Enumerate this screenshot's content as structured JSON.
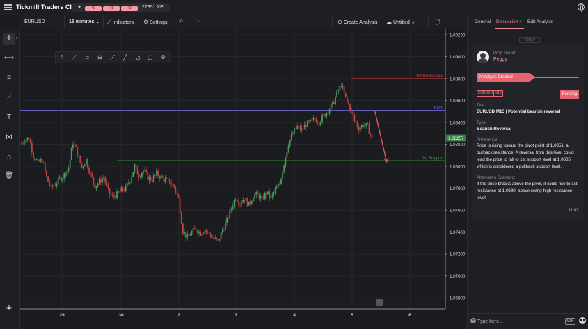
{
  "app": {
    "title": "Tickmill Traders Club",
    "xp_levels": [
      "40",
      "41",
      "42"
    ],
    "xp_value": "27851 XP"
  },
  "toolbar": {
    "symbol": "EURUSD",
    "interval": "15 minutes",
    "indicators": "Indicators",
    "settings": "Settings",
    "create_analysis": "Create Analysis",
    "layout_name": "Untitled"
  },
  "left_tools": [
    "crosshair-icon",
    "horizontal-line-icon",
    "fib-icon",
    "trendline-icon",
    "text-icon",
    "pattern-icon",
    "magnet-icon",
    "trash-icon",
    "layers-icon"
  ],
  "chart_data": {
    "type": "candlestick",
    "symbol": "EURUSD",
    "interval": "15 minutes",
    "y_ticks": [
      "1.09200",
      "1.09000",
      "1.08800",
      "1.08600",
      "1.08400",
      "1.08200",
      "1.08000",
      "1.07800",
      "1.07600",
      "1.07400",
      "1.07200",
      "1.07000",
      "1.06800"
    ],
    "x_ticks": [
      "29",
      "30",
      "2",
      "3",
      "4",
      "5",
      "6"
    ],
    "ylim": [
      1.067,
      1.0925
    ],
    "current_price": "1.08257",
    "levels": [
      {
        "name": "1st Resistance",
        "value": 1.088,
        "color": "#d9414b"
      },
      {
        "name": "Pivot",
        "value": 1.0851,
        "color": "#6b68d8"
      },
      {
        "name": "1st Support",
        "value": 1.0805,
        "color": "#3cb043"
      }
    ],
    "close_path": [
      [
        0,
        1.082
      ],
      [
        3,
        1.0824
      ],
      [
        6,
        1.0826
      ],
      [
        9,
        1.081
      ],
      [
        12,
        1.0803
      ],
      [
        15,
        1.0806
      ],
      [
        18,
        1.079
      ],
      [
        21,
        1.078
      ],
      [
        24,
        1.0784
      ],
      [
        27,
        1.0788
      ],
      [
        30,
        1.0792
      ],
      [
        33,
        1.0798
      ],
      [
        36,
        1.0822
      ],
      [
        39,
        1.0812
      ],
      [
        42,
        1.0799
      ],
      [
        45,
        1.0806
      ],
      [
        48,
        1.0792
      ],
      [
        51,
        1.0782
      ],
      [
        54,
        1.0786
      ],
      [
        57,
        1.079
      ],
      [
        60,
        1.0777
      ],
      [
        63,
        1.0772
      ],
      [
        66,
        1.0774
      ],
      [
        69,
        1.0778
      ],
      [
        72,
        1.078
      ],
      [
        75,
        1.0788
      ],
      [
        78,
        1.08
      ],
      [
        81,
        1.0792
      ],
      [
        84,
        1.0796
      ],
      [
        87,
        1.079
      ],
      [
        90,
        1.0788
      ],
      [
        93,
        1.0793
      ],
      [
        96,
        1.079
      ],
      [
        99,
        1.0787
      ],
      [
        102,
        1.0786
      ],
      [
        105,
        1.0781
      ],
      [
        108,
        1.077
      ],
      [
        111,
        1.0741
      ],
      [
        114,
        1.0735
      ],
      [
        117,
        1.074
      ],
      [
        120,
        1.0743
      ],
      [
        123,
        1.0739
      ],
      [
        126,
        1.0742
      ],
      [
        129,
        1.0738
      ],
      [
        132,
        1.0734
      ],
      [
        135,
        1.0731
      ],
      [
        138,
        1.0742
      ],
      [
        141,
        1.075
      ],
      [
        144,
        1.0762
      ],
      [
        147,
        1.0772
      ],
      [
        150,
        1.0767
      ],
      [
        153,
        1.0771
      ],
      [
        156,
        1.0765
      ],
      [
        159,
        1.0773
      ],
      [
        162,
        1.0774
      ],
      [
        165,
        1.077
      ],
      [
        168,
        1.0776
      ],
      [
        171,
        1.0771
      ],
      [
        174,
        1.0778
      ],
      [
        177,
        1.0784
      ],
      [
        180,
        1.0803
      ],
      [
        183,
        1.0821
      ],
      [
        186,
        1.083
      ],
      [
        189,
        1.0836
      ],
      [
        192,
        1.0833
      ],
      [
        195,
        1.0838
      ],
      [
        198,
        1.084
      ],
      [
        201,
        1.0843
      ],
      [
        204,
        1.0841
      ],
      [
        207,
        1.0846
      ],
      [
        210,
        1.0851
      ],
      [
        213,
        1.0856
      ],
      [
        216,
        1.0866
      ],
      [
        219,
        1.0875
      ],
      [
        222,
        1.0862
      ],
      [
        225,
        1.0853
      ],
      [
        228,
        1.0841
      ],
      [
        231,
        1.0835
      ],
      [
        234,
        1.0838
      ],
      [
        237,
        1.0836
      ],
      [
        240,
        1.0825
      ]
    ],
    "projection": [
      [
        242,
        1.085
      ],
      [
        250,
        1.0804
      ]
    ]
  },
  "panel": {
    "tabs": [
      "General",
      "Discussion",
      "Edit Analysis"
    ],
    "today_label": "TODAY",
    "author_role": "Prop Trader",
    "author_name": "Peggy",
    "status": "Analysis Created",
    "tags": [
      "EURUSD",
      "M15"
    ],
    "pending": "Pending",
    "title_label": "Title",
    "title_value": "EURUSD M15 | Potential bearish reversal",
    "type_label": "Type",
    "type_value": "Bearish Reversal",
    "preference_label": "Preference:",
    "preference_value": "Price is rising toward the pivot point of 1.0851, a pullback resistance. A reversal from this level could lead the price to fall to 1st  support level at 1.0805, which is considered a pullback support level.",
    "alternative_label": "Alternative Scenario:",
    "alternative_value": "If the price breaks above the pivot, it could rise to 1st resistance at 1.0880, above swing-high resistance level",
    "time": "11:07",
    "input_placeholder": "Type here...",
    "gif_label": "GIF"
  }
}
